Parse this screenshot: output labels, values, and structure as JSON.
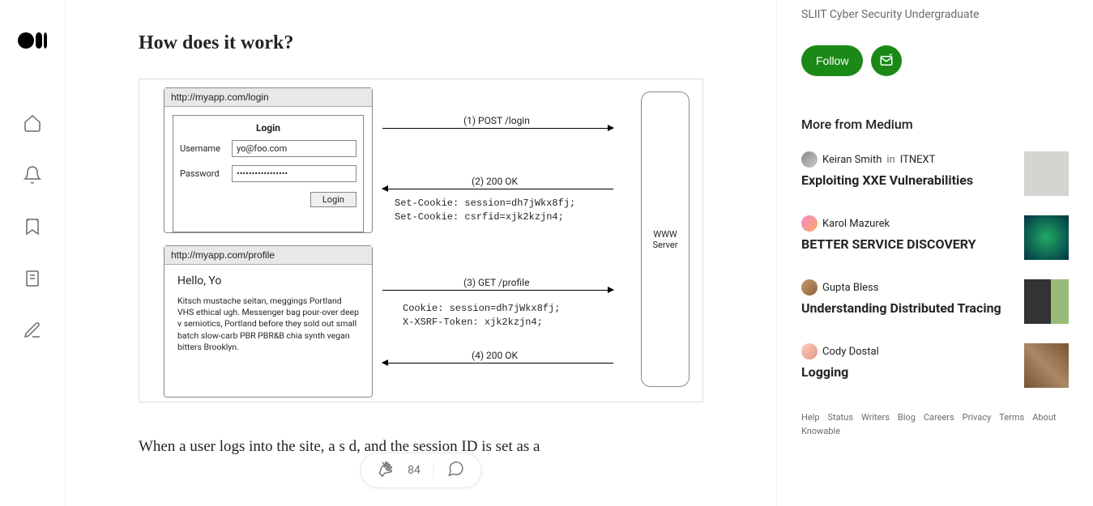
{
  "article": {
    "heading": "How does it work?",
    "body_excerpt": "When a user logs into the site, a s                            d, and the session ID is set as a",
    "clap_count": "84"
  },
  "diagram": {
    "login_url": "http://myapp.com/login",
    "login_title": "Login",
    "username_label": "Username",
    "username_value": "yo@foo.com",
    "password_label": "Password",
    "password_value": "•••••••••••••••••",
    "login_button": "Login",
    "profile_url": "http://myapp.com/profile",
    "profile_greeting": "Hello, Yo",
    "profile_text": "Kitsch mustache seitan, meggings Portland VHS ethical ugh. Messenger bag pour-over deep v semiotics, Portland before they sold out small batch slow-carb PBR PBR&B chia synth vegan bitters Brooklyn.",
    "server_label": "WWW\nServer",
    "arrow1": "(1) POST /login",
    "arrow2": "(2) 200 OK",
    "cookies1": "Set-Cookie: session=dh7jWkx8fj;\nSet-Cookie: csrfid=xjk2kzjn4;",
    "arrow3": "(3) GET /profile",
    "cookies2": "Cookie: session=dh7jWkx8fj;\nX-XSRF-Token: xjk2kzjn4;",
    "arrow4": "(4) 200 OK"
  },
  "sidebar": {
    "bio": "SLIIT Cyber Security Undergraduate",
    "follow_label": "Follow",
    "more_heading": "More from Medium",
    "recs": [
      {
        "author": "Keiran Smith",
        "in": "in",
        "pub": "ITNEXT",
        "title": "Exploiting XXE Vulnerabilities"
      },
      {
        "author": "Karol Mazurek",
        "in": "",
        "pub": "",
        "title": "BETTER SERVICE DISCOVERY"
      },
      {
        "author": "Gupta Bless",
        "in": "",
        "pub": "",
        "title": "Understanding Distributed Tracing"
      },
      {
        "author": "Cody Dostal",
        "in": "",
        "pub": "",
        "title": "Logging"
      }
    ],
    "footer": [
      "Help",
      "Status",
      "Writers",
      "Blog",
      "Careers",
      "Privacy",
      "Terms",
      "About",
      "Knowable"
    ]
  }
}
